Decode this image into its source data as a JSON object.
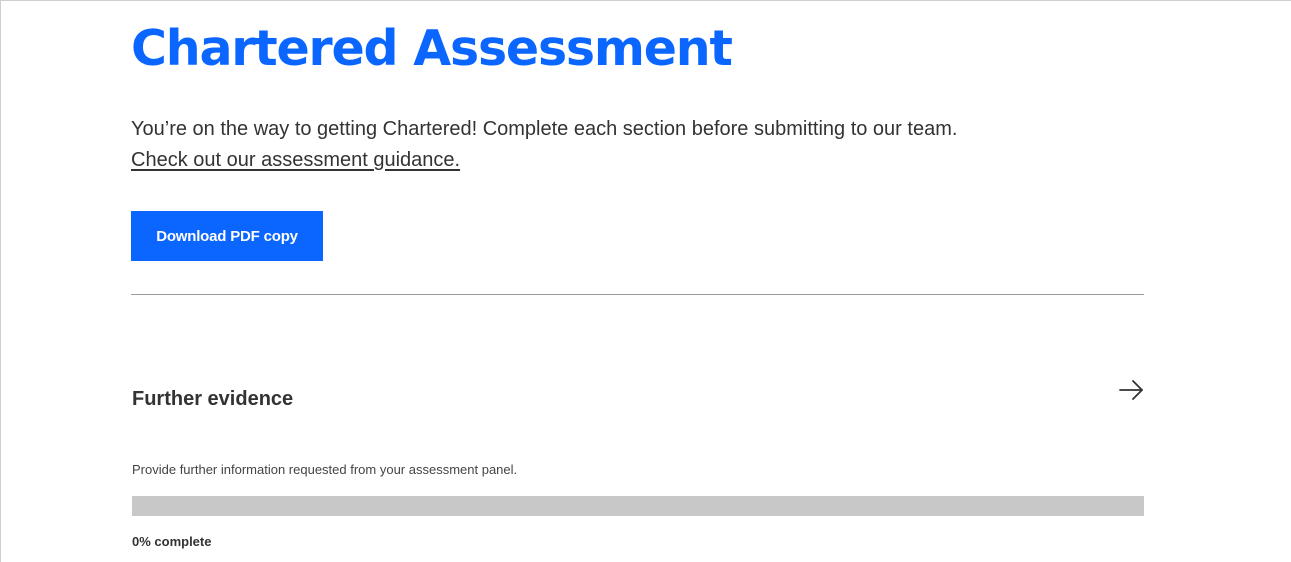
{
  "header": {
    "title": "Chartered Assessment",
    "intro": "You’re on the way to getting Chartered! Complete each section before submitting to our team.",
    "guidance_link": "Check out our assessment guidance."
  },
  "actions": {
    "download_label": "Download PDF copy"
  },
  "sections": [
    {
      "title": "Further evidence",
      "description": "Provide further information requested from your assessment panel.",
      "progress_percent": 0,
      "progress_label": "0% complete",
      "icon": "arrow-right-icon"
    }
  ],
  "colors": {
    "accent": "#0a66ff",
    "text": "#333333",
    "progress_track": "#c8c8c8",
    "divider": "#9a9a9a"
  }
}
